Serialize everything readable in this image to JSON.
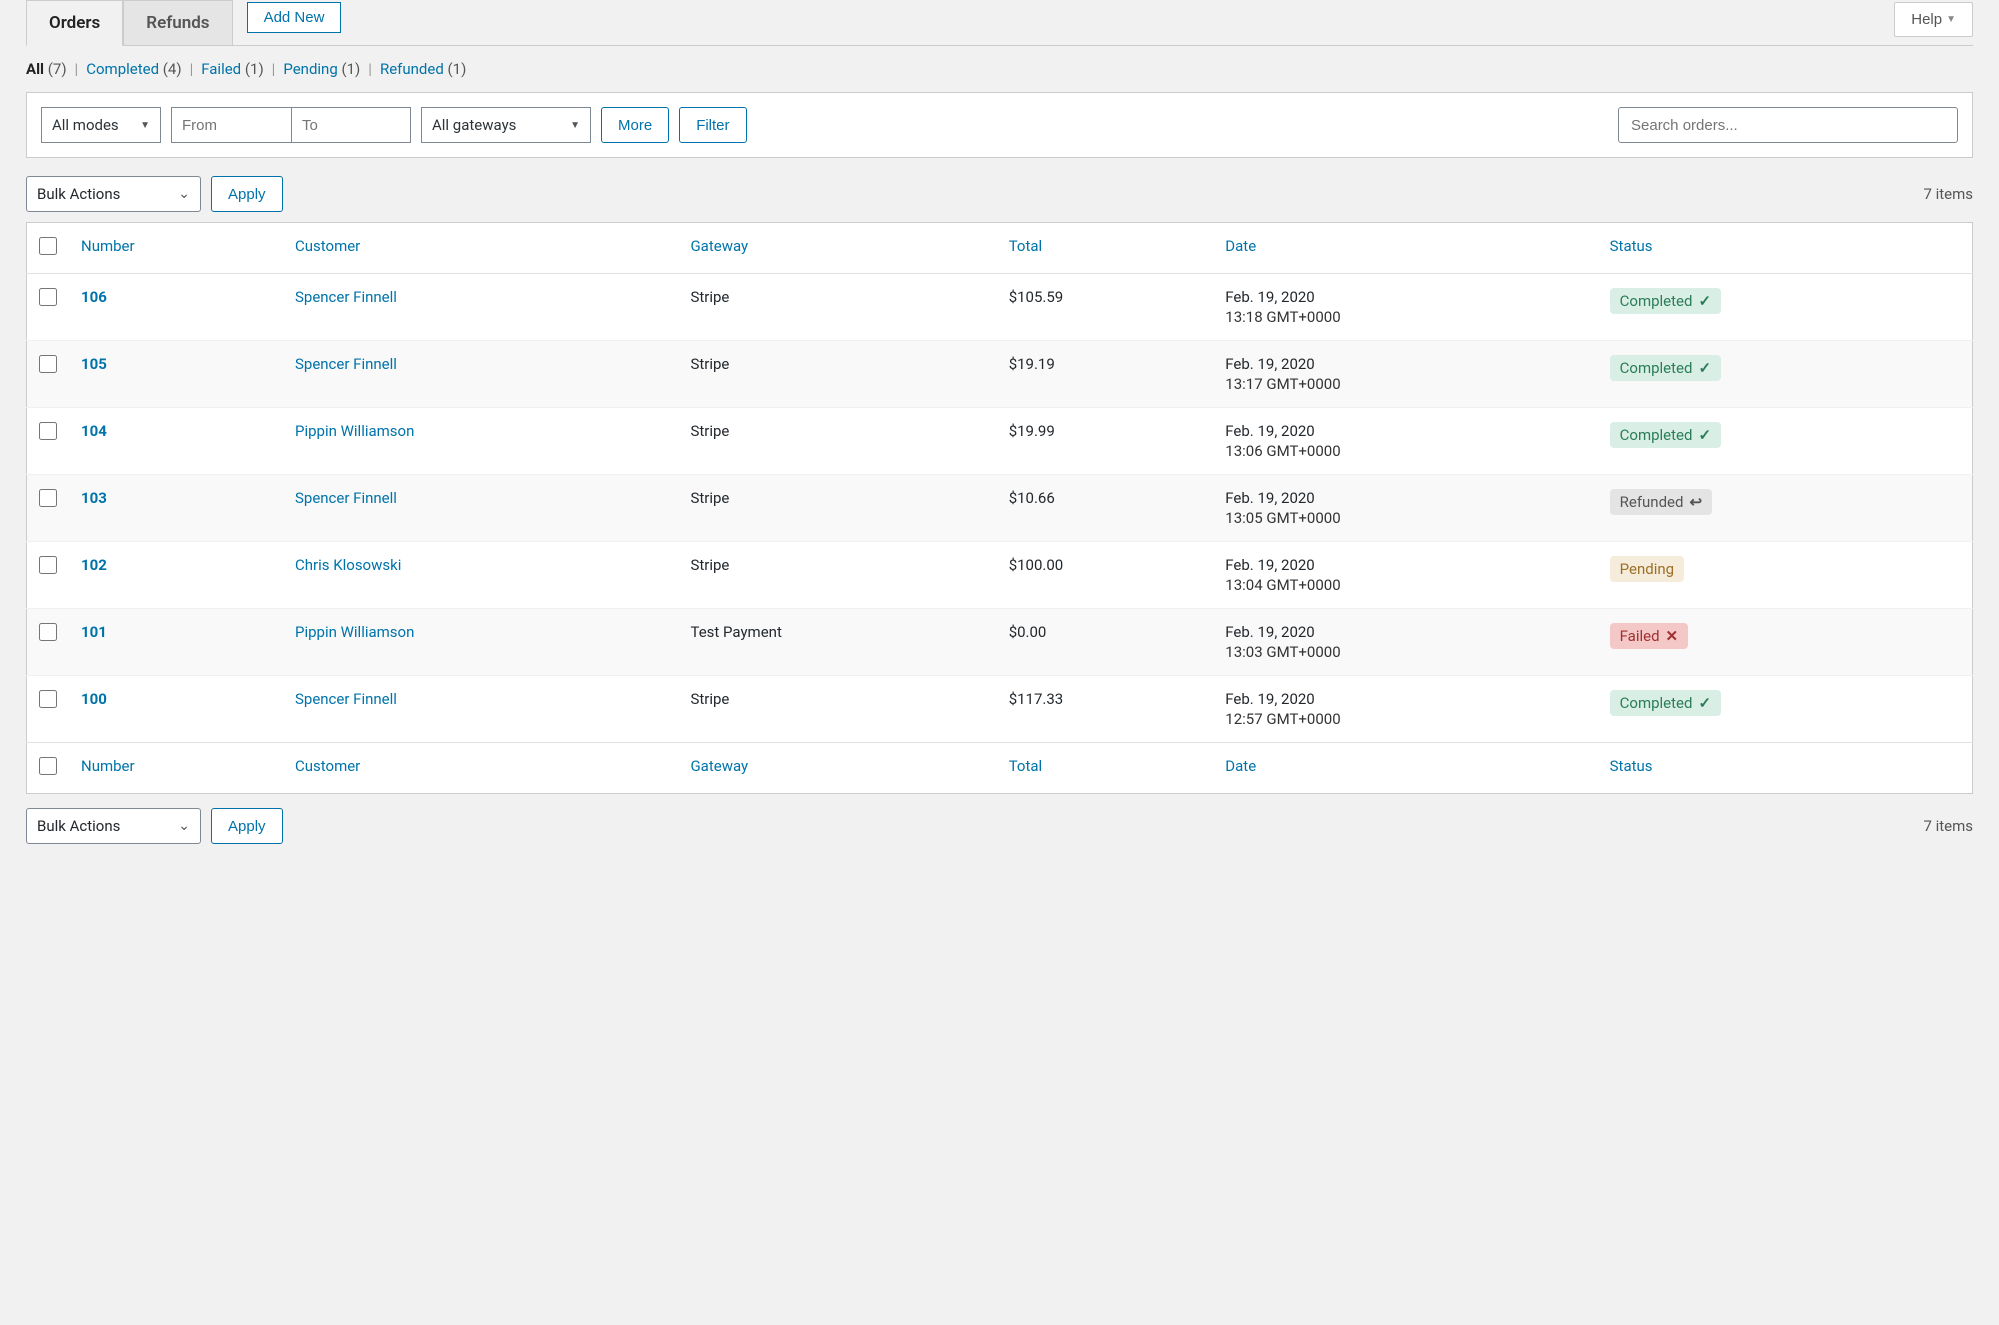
{
  "help_label": "Help",
  "tabs": {
    "orders": "Orders",
    "refunds": "Refunds",
    "add_new": "Add New"
  },
  "filters_subsub": [
    {
      "label": "All",
      "count": "(7)",
      "active": true
    },
    {
      "label": "Completed",
      "count": "(4)",
      "active": false
    },
    {
      "label": "Failed",
      "count": "(1)",
      "active": false
    },
    {
      "label": "Pending",
      "count": "(1)",
      "active": false
    },
    {
      "label": "Refunded",
      "count": "(1)",
      "active": false
    }
  ],
  "filters": {
    "modes": "All modes",
    "from_placeholder": "From",
    "to_placeholder": "To",
    "gateways": "All gateways",
    "more": "More",
    "filter": "Filter",
    "search_placeholder": "Search orders..."
  },
  "bulk": {
    "label": "Bulk Actions",
    "apply": "Apply"
  },
  "items_count": "7 items",
  "columns": {
    "number": "Number",
    "customer": "Customer",
    "gateway": "Gateway",
    "total": "Total",
    "date": "Date",
    "status": "Status"
  },
  "status_labels": {
    "completed": "Completed",
    "refunded": "Refunded",
    "pending": "Pending",
    "failed": "Failed"
  },
  "rows": [
    {
      "number": "106",
      "customer": "Spencer Finnell",
      "gateway": "Stripe",
      "total": "$105.59",
      "date1": "Feb. 19, 2020",
      "date2": "13:18 GMT+0000",
      "status": "completed"
    },
    {
      "number": "105",
      "customer": "Spencer Finnell",
      "gateway": "Stripe",
      "total": "$19.19",
      "date1": "Feb. 19, 2020",
      "date2": "13:17 GMT+0000",
      "status": "completed"
    },
    {
      "number": "104",
      "customer": "Pippin Williamson",
      "gateway": "Stripe",
      "total": "$19.99",
      "date1": "Feb. 19, 2020",
      "date2": "13:06 GMT+0000",
      "status": "completed"
    },
    {
      "number": "103",
      "customer": "Spencer Finnell",
      "gateway": "Stripe",
      "total": "$10.66",
      "date1": "Feb. 19, 2020",
      "date2": "13:05 GMT+0000",
      "status": "refunded"
    },
    {
      "number": "102",
      "customer": "Chris Klosowski",
      "gateway": "Stripe",
      "total": "$100.00",
      "date1": "Feb. 19, 2020",
      "date2": "13:04 GMT+0000",
      "status": "pending"
    },
    {
      "number": "101",
      "customer": "Pippin Williamson",
      "gateway": "Test Payment",
      "total": "$0.00",
      "date1": "Feb. 19, 2020",
      "date2": "13:03 GMT+0000",
      "status": "failed"
    },
    {
      "number": "100",
      "customer": "Spencer Finnell",
      "gateway": "Stripe",
      "total": "$117.33",
      "date1": "Feb. 19, 2020",
      "date2": "12:57 GMT+0000",
      "status": "completed"
    }
  ]
}
